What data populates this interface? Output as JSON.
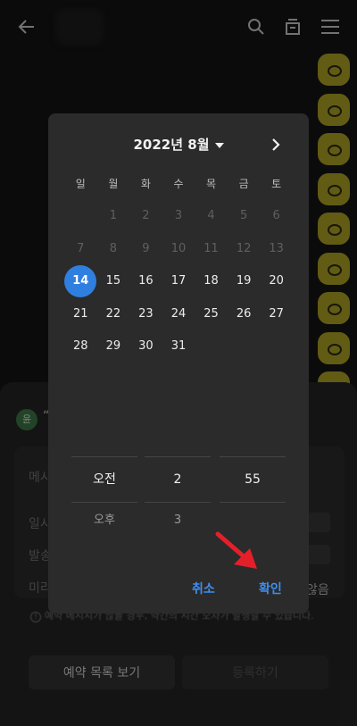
{
  "colors": {
    "accent": "#2f7fe0",
    "button_text": "#3d8ff0",
    "bubble": "#b3a626",
    "arrow": "#e3202a"
  },
  "topbar": {
    "back_icon": "arrow-left-icon",
    "search_icon": "search-icon",
    "archive_icon": "archive-icon",
    "menu_icon": "menu-icon"
  },
  "background_sheet": {
    "avatar_text": "윤",
    "quote": "“",
    "row_labels": [
      "메시",
      "일시",
      "발송",
      "미리"
    ],
    "none_label": "않음",
    "notice": "예약 메시지가 많을 경우, 약간의 시간 오차가 발생할 수 있습니다.",
    "list_button": "예약 목록 보기",
    "register_button": "등록하기"
  },
  "calendar": {
    "month_label": "2022년 8월",
    "weekdays": [
      "일",
      "월",
      "화",
      "수",
      "목",
      "금",
      "토"
    ],
    "weeks": [
      [
        {
          "d": ""
        },
        {
          "d": "1",
          "s": "disabled"
        },
        {
          "d": "2",
          "s": "disabled"
        },
        {
          "d": "3",
          "s": "disabled"
        },
        {
          "d": "4",
          "s": "disabled"
        },
        {
          "d": "5",
          "s": "disabled"
        },
        {
          "d": "6",
          "s": "disabled"
        }
      ],
      [
        {
          "d": "7",
          "s": "disabled"
        },
        {
          "d": "8",
          "s": "disabled"
        },
        {
          "d": "9",
          "s": "disabled"
        },
        {
          "d": "10",
          "s": "disabled"
        },
        {
          "d": "11",
          "s": "disabled"
        },
        {
          "d": "12",
          "s": "disabled"
        },
        {
          "d": "13",
          "s": "disabled"
        }
      ],
      [
        {
          "d": "14",
          "s": "selected"
        },
        {
          "d": "15",
          "s": "active"
        },
        {
          "d": "16",
          "s": "active"
        },
        {
          "d": "17",
          "s": "active"
        },
        {
          "d": "18",
          "s": "active"
        },
        {
          "d": "19",
          "s": "active"
        },
        {
          "d": "20",
          "s": "active"
        }
      ],
      [
        {
          "d": "21",
          "s": "active"
        },
        {
          "d": "22",
          "s": "active"
        },
        {
          "d": "23",
          "s": "active"
        },
        {
          "d": "24",
          "s": "active"
        },
        {
          "d": "25",
          "s": "active"
        },
        {
          "d": "26",
          "s": "active"
        },
        {
          "d": "27",
          "s": "active"
        }
      ],
      [
        {
          "d": "28",
          "s": "active"
        },
        {
          "d": "29",
          "s": "active"
        },
        {
          "d": "30",
          "s": "active"
        },
        {
          "d": "31",
          "s": "active"
        },
        {
          "d": ""
        },
        {
          "d": ""
        },
        {
          "d": ""
        }
      ]
    ]
  },
  "time_picker": {
    "ampm": {
      "selected": "오전",
      "next": "오후"
    },
    "hour": {
      "selected": "2",
      "next": "3"
    },
    "minute": {
      "selected": "55",
      "next": ""
    }
  },
  "dialog": {
    "cancel_label": "취소",
    "confirm_label": "확인"
  }
}
